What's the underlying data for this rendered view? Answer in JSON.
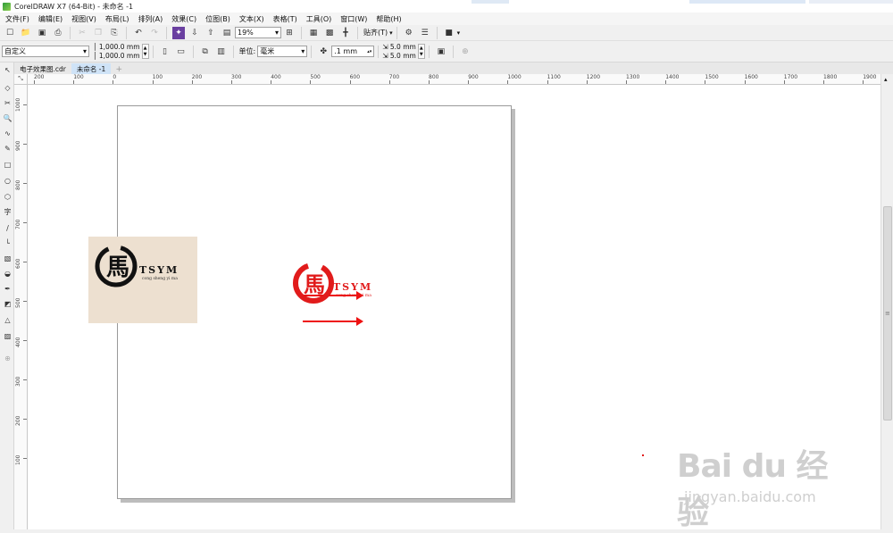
{
  "titlebar": {
    "title": "CorelDRAW X7 (64-Bit) - 未命名 -1"
  },
  "menubar": {
    "items": [
      "文件(F)",
      "编辑(E)",
      "视图(V)",
      "布局(L)",
      "排列(A)",
      "效果(C)",
      "位图(B)",
      "文本(X)",
      "表格(T)",
      "工具(O)",
      "窗口(W)",
      "帮助(H)"
    ]
  },
  "toolbar": {
    "zoom": "19%",
    "snap_label": "贴齐(T)"
  },
  "propertybar": {
    "paper_preset": "自定义",
    "width": "1,000.0 mm",
    "height": "1,000.0 mm",
    "units_label": "单位:",
    "units": "毫米",
    "nudge": ".1 mm",
    "dup_x": "5.0 mm",
    "dup_y": "5.0 mm"
  },
  "tabs": [
    {
      "label": "电子效果图.cdr",
      "active": false
    },
    {
      "label": "未命名 -1",
      "active": true
    }
  ],
  "hruler": {
    "labels": [
      "200",
      "100",
      "0",
      "100",
      "200",
      "300",
      "400",
      "500",
      "600",
      "700",
      "800",
      "900",
      "1000",
      "1100",
      "1200",
      "1300",
      "1400",
      "1500",
      "1600",
      "1700",
      "1800",
      "1900"
    ]
  },
  "vruler": {
    "labels": [
      "1000",
      "900",
      "800",
      "700",
      "600",
      "500",
      "400",
      "300",
      "200",
      "100"
    ]
  },
  "canvas": {
    "logo_text": "TSYM",
    "logo_subtext": "cong sheng yi ma",
    "logo_glyph": "馬",
    "accent_color": "#e11b1b"
  },
  "watermark": {
    "brand": "Bai du 经验",
    "url": "jingyan.baidu.com"
  }
}
